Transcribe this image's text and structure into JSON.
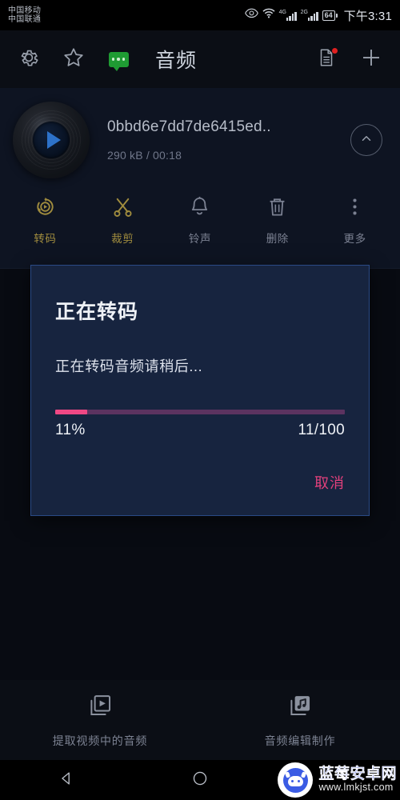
{
  "status_bar": {
    "carrier_primary": "中国移动",
    "carrier_secondary": "中国联通",
    "icons": [
      "eye-icon",
      "wifi-icon",
      "signal-4g-icon",
      "signal-2g-icon",
      "battery-icon"
    ],
    "signal_1_label": "4G",
    "signal_2_label": "2G",
    "battery_level": "64",
    "time": "下午3:31"
  },
  "toolbar": {
    "settings_icon": "gear-icon",
    "favorites_icon": "star-icon",
    "feedback_icon": "chat-bubble-icon",
    "title": "音频",
    "document_icon": "document-icon",
    "add_icon": "plus-icon"
  },
  "audio_item": {
    "play_icon": "play-icon",
    "file_name": "0bbd6e7dd7de6415ed..",
    "file_info": "290 kB / 00:18",
    "collapse_icon": "chevron-up-circle-icon"
  },
  "actions": [
    {
      "label": "转码",
      "icon": "transcode-icon",
      "accent": "#a08c3e"
    },
    {
      "label": "裁剪",
      "icon": "scissors-icon",
      "accent": "#a08c3e"
    },
    {
      "label": "铃声",
      "icon": "bell-icon",
      "accent": "#7b8192"
    },
    {
      "label": "删除",
      "icon": "trash-icon",
      "accent": "#7b8192"
    },
    {
      "label": "更多",
      "icon": "more-vertical-icon",
      "accent": "#7b8192"
    }
  ],
  "dialog": {
    "title": "正在转码",
    "message": "正在转码音频请稍后...",
    "progress_percent_label": "11%",
    "progress_count_label": "11/100",
    "progress_value": 11,
    "progress_max": 100,
    "cancel_label": "取消",
    "fill_color": "#ef4884",
    "track_color": "#5c3360",
    "cancel_color": "#e2407c",
    "background_color": "#17243f",
    "border_color": "#2a4a86"
  },
  "bottom_bar": [
    {
      "label": "提取视频中的音频",
      "icon": "video-extract-icon"
    },
    {
      "label": "音频编辑制作",
      "icon": "music-edit-icon"
    }
  ],
  "nav_bar": {
    "back_icon": "back-triangle-icon",
    "home_icon": "home-circle-icon"
  },
  "watermark": {
    "logo_icon": "android-mascot-icon",
    "site_name": "蓝莓安卓网",
    "site_url": "www.lmkjst.com"
  }
}
